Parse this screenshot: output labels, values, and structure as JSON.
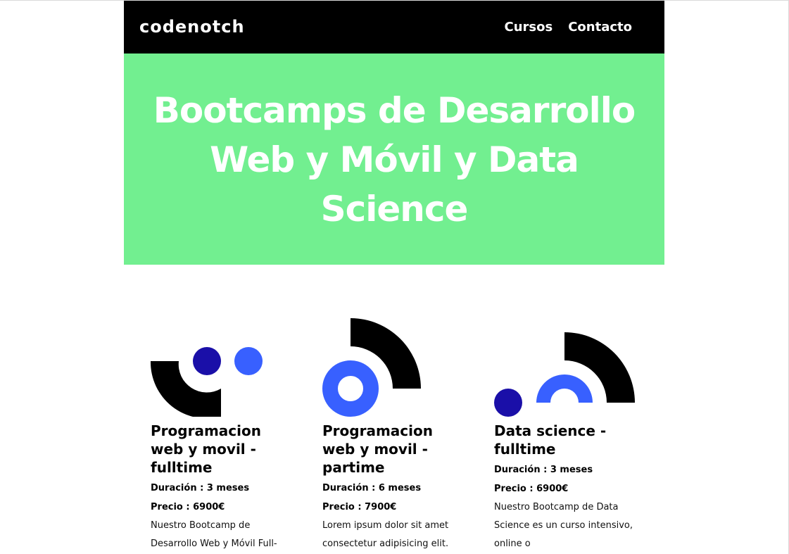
{
  "header": {
    "logo_text": "codenotch",
    "nav": [
      "Cursos",
      "Contacto"
    ]
  },
  "hero": {
    "title": "Bootcamps de Desarrollo Web y Móvil y Data Science"
  },
  "courses": [
    {
      "title": "Programacion web y movil - fulltime",
      "duration": "Duración : 3 meses",
      "price": "Precio : 6900€",
      "description": "Nuestro Bootcamp de Desarrollo Web y Móvil Full-Time es un curso intensivo"
    },
    {
      "title": "Programacion web y movil - partime",
      "duration": "Duración : 6 meses",
      "price": "Precio : 7900€",
      "description": "Lorem ipsum dolor sit amet consectetur adipisicing elit. Culpa vitae, sequi, excepturi"
    },
    {
      "title": "Data science - fulltime",
      "duration": "Duración : 3 meses",
      "price": "Precio : 6900€",
      "description": "Nuestro Bootcamp de Data Science es un curso intensivo, online o"
    }
  ],
  "colors": {
    "navbar_bg": "#000000",
    "hero_bg": "#72ef90",
    "shape_black": "#000000",
    "shape_navy": "#1a0fa8",
    "shape_blue": "#3860ff"
  }
}
